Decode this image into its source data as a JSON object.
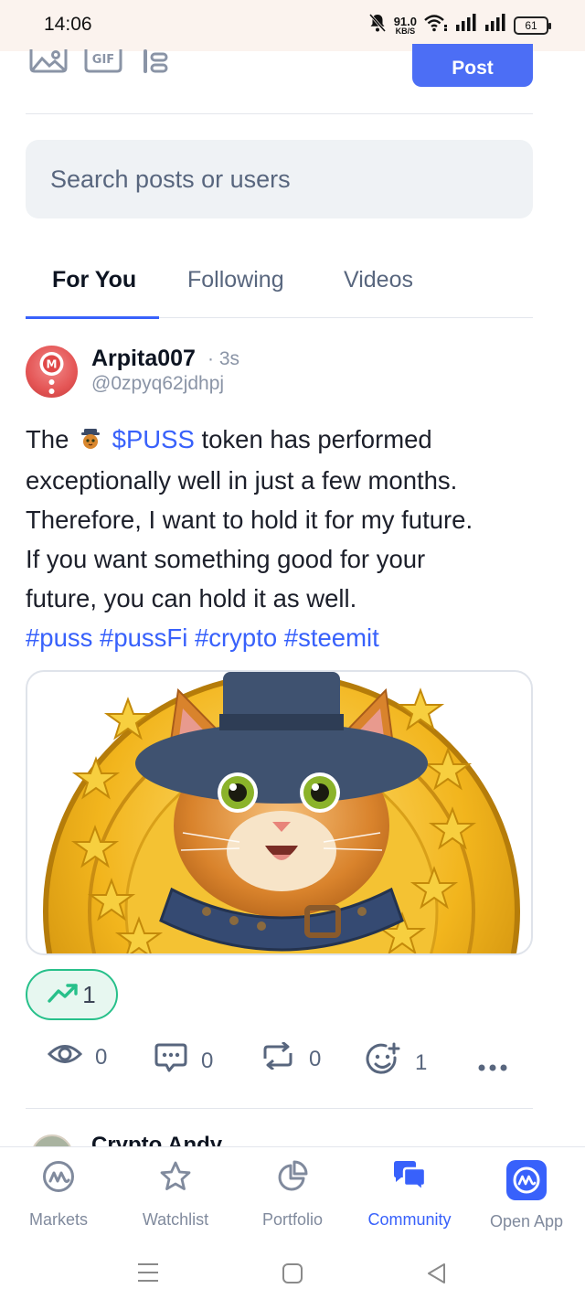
{
  "status_bar": {
    "time": "14:06",
    "net_speed_value": "91.0",
    "net_speed_unit": "KB/S",
    "battery": "61"
  },
  "composer": {
    "post_label": "Post",
    "icons": [
      "image-icon",
      "gif-icon",
      "poll-icon"
    ]
  },
  "search": {
    "placeholder": "Search posts or users"
  },
  "tabs": [
    {
      "label": "For You",
      "active": true
    },
    {
      "label": "Following",
      "active": false
    },
    {
      "label": "Videos",
      "active": false
    }
  ],
  "post": {
    "author": "Arpita007",
    "time": "· 3s",
    "handle": "@0zpyq62jdhpj",
    "text_the": "The",
    "token": "$PUSS",
    "text_line1_rest": "token has performed",
    "text_line2": "exceptionally well in just a few months.",
    "text_line3": "Therefore, I want to hold it for my future.",
    "text_line4": "If you want something good for your",
    "text_line5": "future, you can hold it as well.",
    "hashtags": [
      "#puss",
      "#pussFi",
      "#crypto",
      "#steemit"
    ],
    "bullish_count": "1",
    "actions": {
      "views": "0",
      "comments": "0",
      "reposts": "0",
      "reactions": "1"
    }
  },
  "next_post": {
    "author": "Crypto Andy"
  },
  "bottom_nav": [
    {
      "label": "Markets",
      "icon": "markets-icon",
      "active": false
    },
    {
      "label": "Watchlist",
      "icon": "star-icon",
      "active": false
    },
    {
      "label": "Portfolio",
      "icon": "pie-chart-icon",
      "active": false
    },
    {
      "label": "Community",
      "icon": "chat-bubbles-icon",
      "active": true
    },
    {
      "label": "Open App",
      "icon": "app-logo-icon",
      "active": false
    }
  ],
  "colors": {
    "accent": "#3861fb",
    "post_button": "#4c6ef5",
    "bullish_green": "#27c08a",
    "muted_text": "#58667e",
    "status_bar_bg": "#fbf3ee"
  }
}
